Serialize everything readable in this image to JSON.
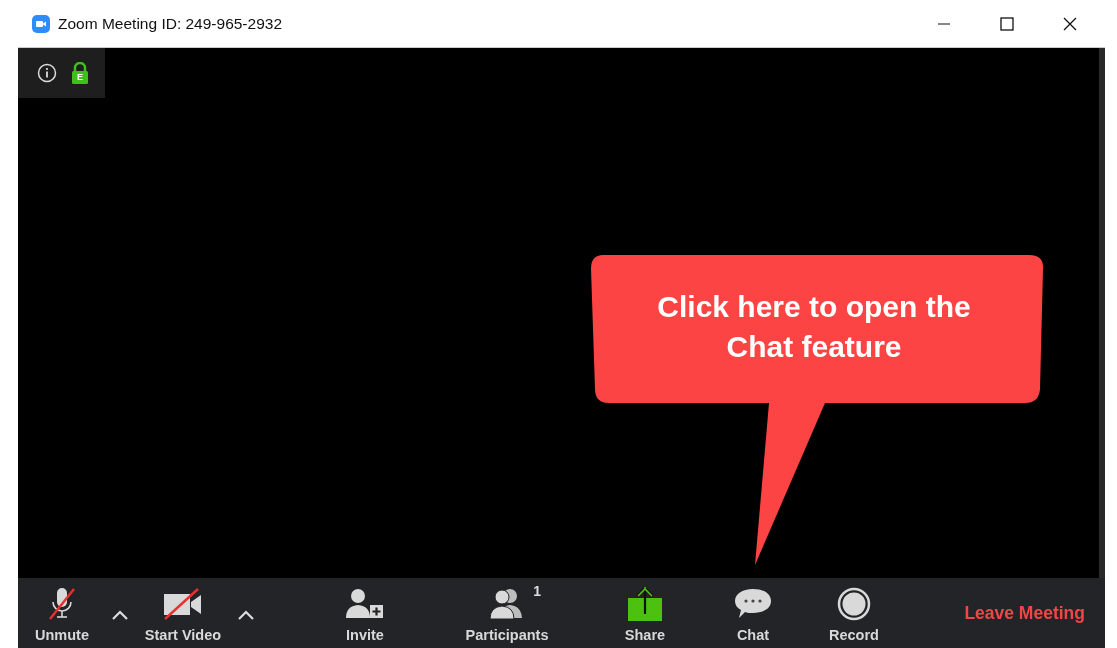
{
  "window": {
    "title": "Zoom Meeting ID: 249-965-2932"
  },
  "meeting_info": {
    "lock_badge": "E"
  },
  "callout": {
    "text": "Click here to open the Chat feature"
  },
  "toolbar": {
    "buttons": [
      {
        "kind": "audio",
        "label": "Unmute",
        "muted": true,
        "menu": true
      },
      {
        "kind": "video",
        "label": "Start Video",
        "muted": true,
        "menu": true
      },
      {
        "kind": "invite",
        "label": "Invite"
      },
      {
        "kind": "participants",
        "label": "Participants",
        "count": "1"
      },
      {
        "kind": "share",
        "label": "Share"
      },
      {
        "kind": "chat",
        "label": "Chat"
      },
      {
        "kind": "record",
        "label": "Record"
      }
    ],
    "leave": "Leave Meeting"
  }
}
